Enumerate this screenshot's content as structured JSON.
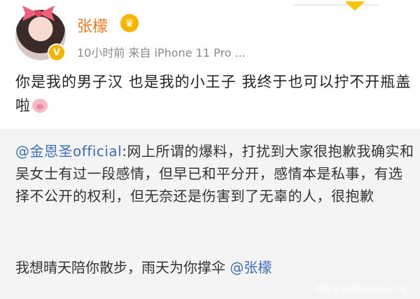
{
  "header": {
    "username": "张檬",
    "meta": "10小时前  来自 iPhone 11 Pro ...",
    "vbadge": "V",
    "crown": "♛"
  },
  "post": {
    "text": "你是我的男子汉 也是我的小王子 我终于也可以拧不开瓶盖啦"
  },
  "repost": {
    "mention": "@金恩圣official",
    "body": ":网上所谓的爆料，打扰到大家很抱歉我确实和吴女士有过一段感情，但早已和平分开，感情本是私事，有选择不公开的权利，但无奈还是伤害到了无辜的人，很抱歉",
    "line2_text": "我想晴天陪你散步，雨天为你撑伞 ",
    "line2_mention": "@张檬"
  },
  "watermark": "搜狐号@我和我的小时候"
}
